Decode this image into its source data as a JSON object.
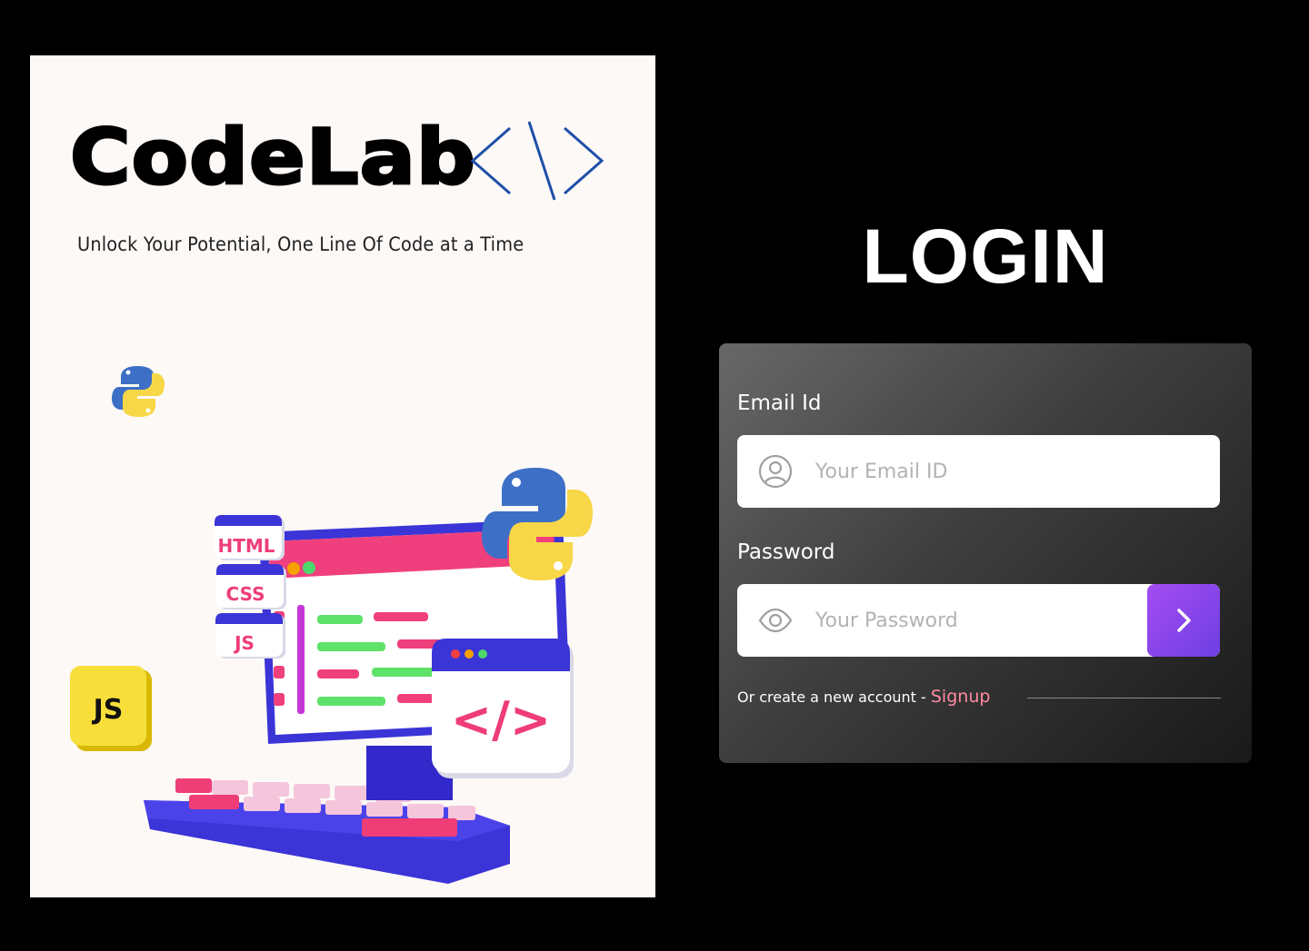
{
  "brand": {
    "name": "CodeLab",
    "tagline": "Unlock Your Potential, One Line Of Code at a Time"
  },
  "illustration": {
    "tags": [
      "HTML",
      "CSS",
      "JS"
    ],
    "js_badge": "JS",
    "code_window": "</>"
  },
  "login": {
    "title": "LOGIN",
    "email": {
      "label": "Email Id",
      "placeholder": "Your Email ID",
      "value": ""
    },
    "password": {
      "label": "Password",
      "placeholder": "Your Password",
      "value": ""
    },
    "signup_prompt": "Or create a new account - ",
    "signup_link": "Signup"
  },
  "colors": {
    "accent_purple": "#7b3fe8",
    "signup_pink": "#ff8aa0",
    "brand_blue": "#1f4fa8"
  }
}
